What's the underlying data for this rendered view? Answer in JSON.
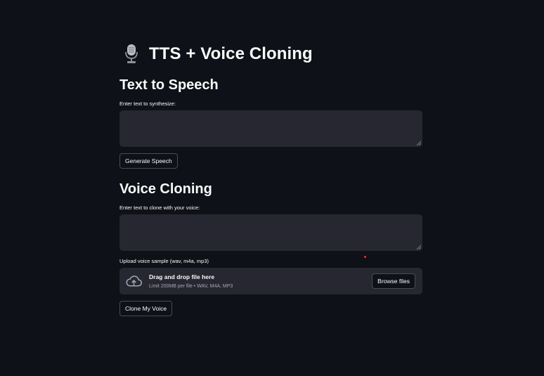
{
  "app": {
    "title": "TTS + Voice Cloning",
    "title_icon": "studio-microphone-icon",
    "background_color": "#0e1117"
  },
  "tts": {
    "heading": "Text to Speech",
    "input_label": "Enter text to synthesize:",
    "input_value": "",
    "button_label": "Generate Speech"
  },
  "cloning": {
    "heading": "Voice Cloning",
    "input_label": "Enter text to clone with your voice:",
    "input_value": "",
    "upload_label": "Upload voice sample (wav, m4a, mp3)",
    "dropzone": {
      "icon": "cloud-upload-icon",
      "title": "Drag and drop file here",
      "subtitle": "Limit 200MB per file • WAV, M4A, MP3",
      "browse_label": "Browse files"
    },
    "button_label": "Clone My Voice"
  },
  "colors": {
    "input_background": "#262730",
    "text": "#fafafa",
    "muted_text": "#a3a8b8",
    "button_border": "#4a4c55",
    "status_dot": "#ff2b2b"
  }
}
